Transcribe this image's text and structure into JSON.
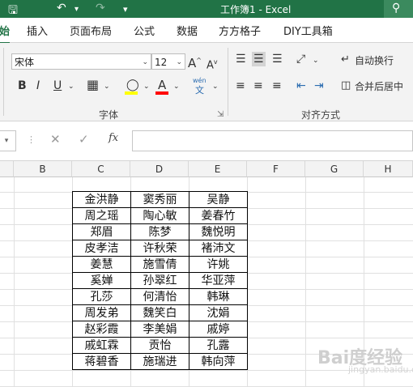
{
  "titlebar": {
    "title": "工作簿1  -  Excel",
    "save_icon": "save-icon",
    "undo_icon": "undo-icon",
    "redo_icon": "redo-icon",
    "search_icon": "search-icon"
  },
  "tabs": [
    {
      "label": "始",
      "active": true
    },
    {
      "label": "插入"
    },
    {
      "label": "页面布局"
    },
    {
      "label": "公式"
    },
    {
      "label": "数据"
    },
    {
      "label": "方方格子"
    },
    {
      "label": "DIY工具箱"
    }
  ],
  "ribbon": {
    "font_name": "宋体",
    "font_size": "12",
    "grow_font": "A",
    "shrink_font": "A",
    "bold": "B",
    "italic": "I",
    "underline": "U",
    "phonetic": "wén",
    "font_color_letter": "A",
    "font_group_label": "字体",
    "wrap_text": "自动换行",
    "merge_center": "合并后居中",
    "align_group_label": "对齐方式",
    "highlight_color": "#ffff00",
    "font_color": "#ff0000"
  },
  "formula_bar": {
    "cancel": "✕",
    "confirm": "✓",
    "fx": "fx",
    "value": ""
  },
  "columns": [
    "B",
    "C",
    "D",
    "E",
    "F",
    "G",
    "H"
  ],
  "table": [
    [
      "金洪静",
      "窦秀丽",
      "吴静"
    ],
    [
      "周之瑶",
      "陶心敏",
      "姜春竹"
    ],
    [
      "郑眉",
      "陈梦",
      "魏悦明"
    ],
    [
      "皮孝洁",
      "许秋荣",
      "褚沛文"
    ],
    [
      "姜慧",
      "施雪倩",
      "许姚"
    ],
    [
      "奚婵",
      "孙翠红",
      "华亚萍"
    ],
    [
      "孔莎",
      "何清怡",
      "韩琳"
    ],
    [
      "周发弟",
      "魏笑白",
      "沈娟"
    ],
    [
      "赵彩霞",
      "李美娟",
      "戚婷"
    ],
    [
      "戚虹霖",
      "贡怡",
      "孔露"
    ],
    [
      "蒋碧香",
      "施瑞进",
      "韩向萍"
    ]
  ],
  "watermark": {
    "text": "Bai度经验",
    "sub": "jingyan.baidu.com"
  }
}
